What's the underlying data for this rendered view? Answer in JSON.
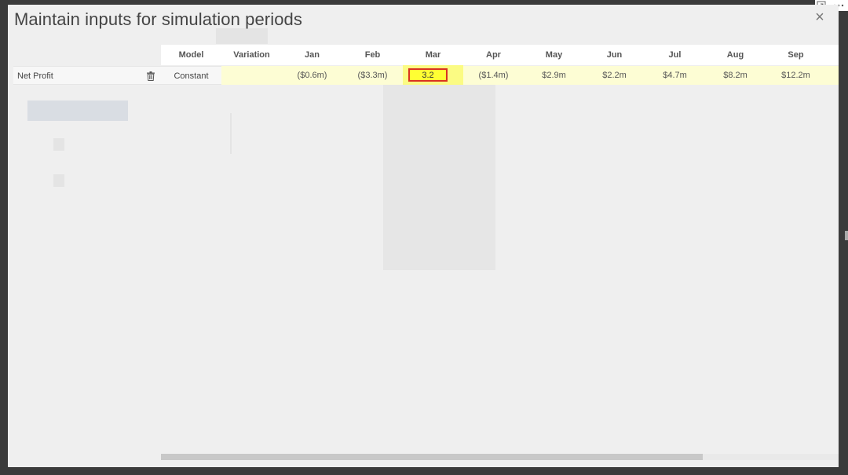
{
  "dialog": {
    "title": "Maintain inputs for simulation periods",
    "close_label": "×"
  },
  "grid": {
    "columns": [
      "Model",
      "Variation",
      "Jan",
      "Feb",
      "Mar",
      "Apr",
      "May",
      "Jun",
      "Jul",
      "Aug",
      "Sep"
    ],
    "rows": [
      {
        "name": "Net Profit",
        "model": "Constant",
        "variation": "",
        "values": [
          "($0.6m)",
          "($3.3m)",
          "3.2",
          "($1.4m)",
          "$2.9m",
          "$2.2m",
          "$4.7m",
          "$8.2m",
          "$12.2m"
        ]
      }
    ],
    "active_cell": {
      "column": "Mar",
      "value": "3.2"
    }
  },
  "scrollbar": {
    "visible_fraction": 0.8
  },
  "colors": {
    "row_highlight": "#fdfdd4",
    "active_column": "#fbfb83",
    "active_input": "#ffff33",
    "active_border": "#d9331f"
  },
  "icons": [
    "expand-icon",
    "more-options-icon",
    "close-icon",
    "trash-icon"
  ]
}
